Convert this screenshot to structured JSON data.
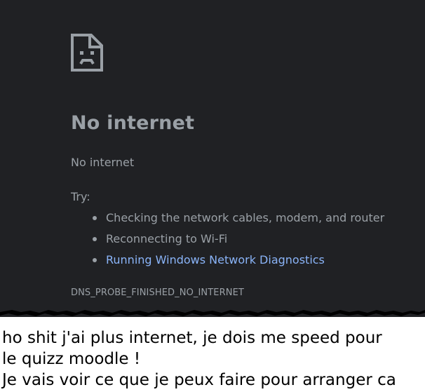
{
  "browser_error": {
    "icon": "sad-document-icon",
    "title": "No internet",
    "subtitle": "No internet",
    "try_label": "Try:",
    "suggestions": [
      {
        "label": "Checking the network cables, modem, and router",
        "is_link": false
      },
      {
        "label": "Reconnecting to Wi-Fi",
        "is_link": false
      },
      {
        "label": "Running Windows Network Diagnostics",
        "is_link": true
      }
    ],
    "error_code": "DNS_PROBE_FINISHED_NO_INTERNET"
  },
  "caption": {
    "lines": [
      "ho shit j'ai plus internet, je dois me speed pour",
      "le quizz moodle !",
      "Je vais voir ce que je peux faire pour arranger ca"
    ]
  },
  "colors": {
    "background": "#202124",
    "text": "#9aa0a6",
    "link": "#8ab4f8"
  }
}
